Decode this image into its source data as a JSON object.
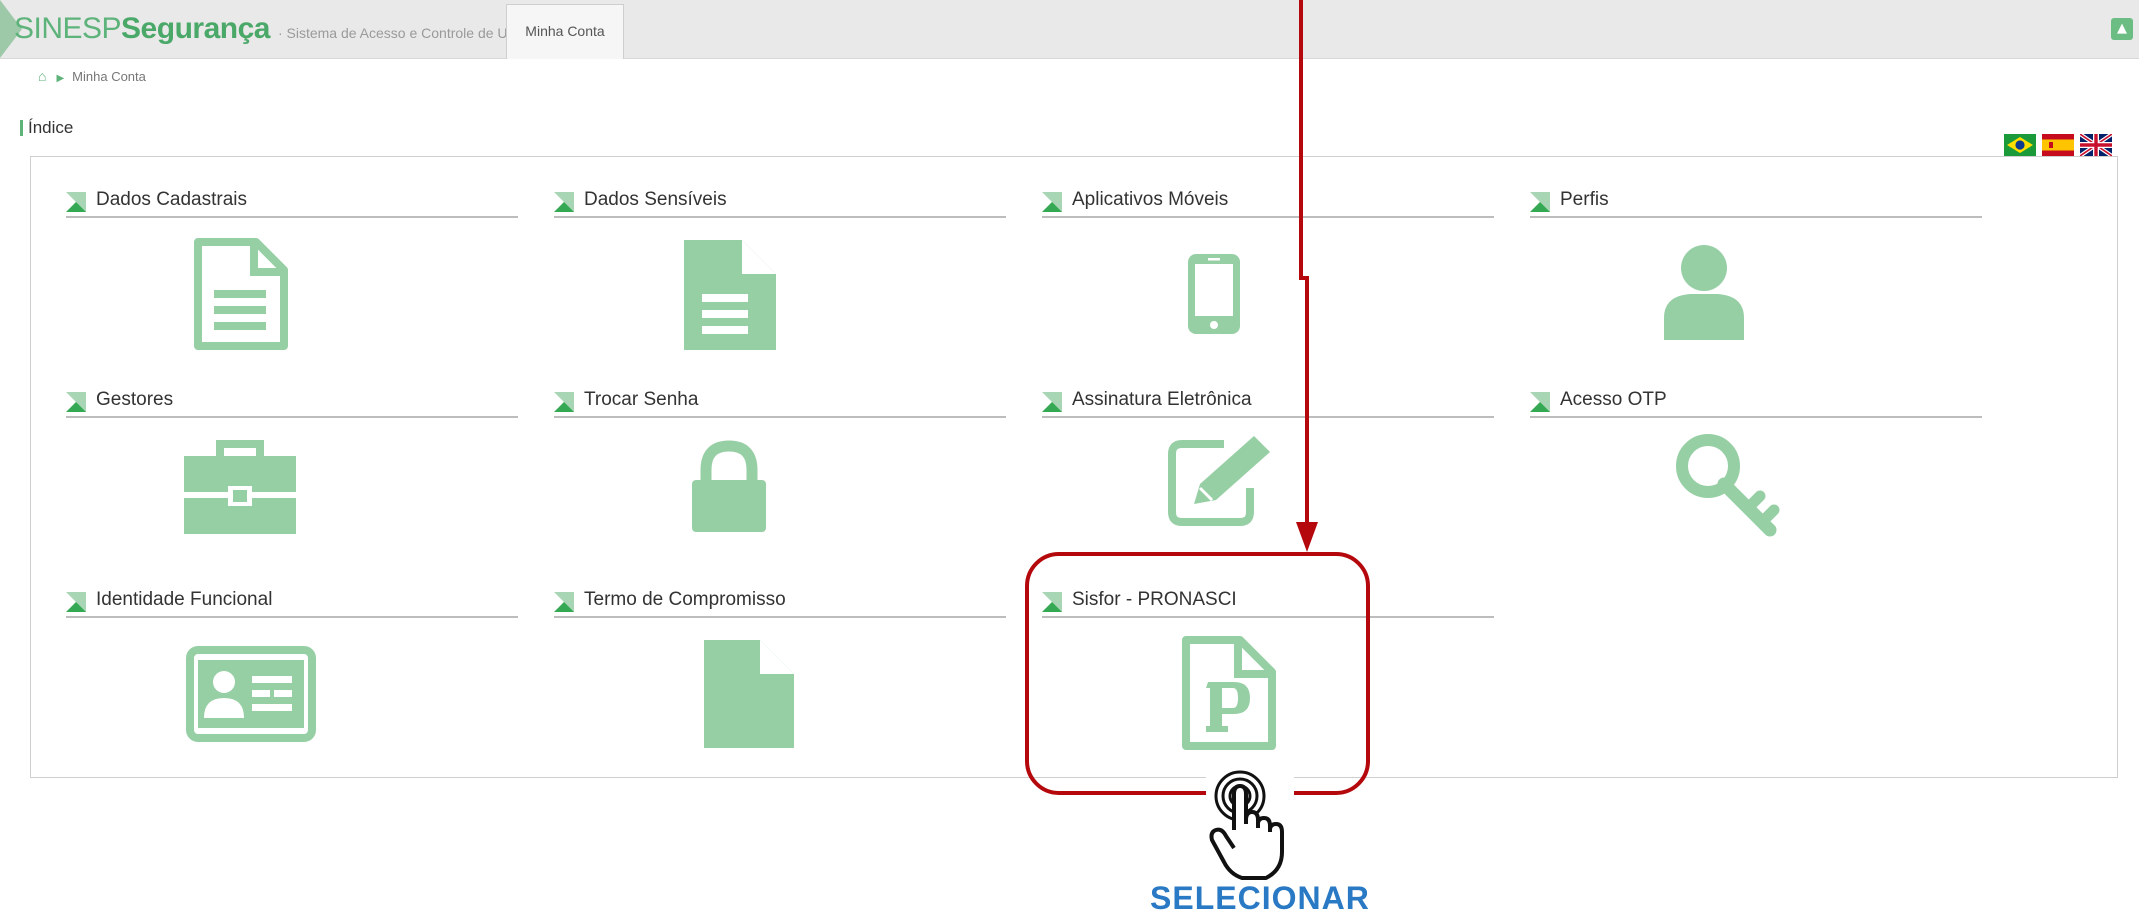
{
  "header": {
    "brand_light": "SINESP",
    "brand_bold": "Segurança",
    "brand_subtitle": "· Sistema de Acesso e Controle de Usuários",
    "tab_account": "Minha Conta",
    "user_menu_icon": "chevron-up-icon"
  },
  "breadcrumb": {
    "home_icon": "home-icon",
    "separator_icon": "caret-right-icon",
    "current": "Minha Conta"
  },
  "index": {
    "title": "Índice"
  },
  "languages": [
    {
      "name": "brazil-flag-icon"
    },
    {
      "name": "spain-flag-icon"
    },
    {
      "name": "uk-flag-icon"
    }
  ],
  "tiles": [
    {
      "label": "Dados Cadastrais",
      "icon": "document-outline-icon"
    },
    {
      "label": "Dados Sensíveis",
      "icon": "document-solid-icon"
    },
    {
      "label": "Aplicativos Móveis",
      "icon": "mobile-phone-icon"
    },
    {
      "label": "Perfis",
      "icon": "user-icon"
    },
    {
      "label": "Gestores",
      "icon": "briefcase-icon"
    },
    {
      "label": "Trocar Senha",
      "icon": "lock-icon"
    },
    {
      "label": "Assinatura Eletrônica",
      "icon": "edit-pencil-icon"
    },
    {
      "label": "Acesso OTP",
      "icon": "key-icon"
    },
    {
      "label": "Identidade Funcional",
      "icon": "id-card-icon"
    },
    {
      "label": "Termo de Compromisso",
      "icon": "blank-file-icon"
    },
    {
      "label": "Sisfor - PRONASCI",
      "icon": "p-file-icon"
    }
  ],
  "annotation": {
    "callout_label": "SELECIONAR",
    "pointer_icon": "hand-pointer-icon",
    "accent_color": "#b4080c",
    "label_color": "#2979c4"
  },
  "colors": {
    "icon_green": "#97cfa5",
    "brand_green": "#4aa869"
  }
}
